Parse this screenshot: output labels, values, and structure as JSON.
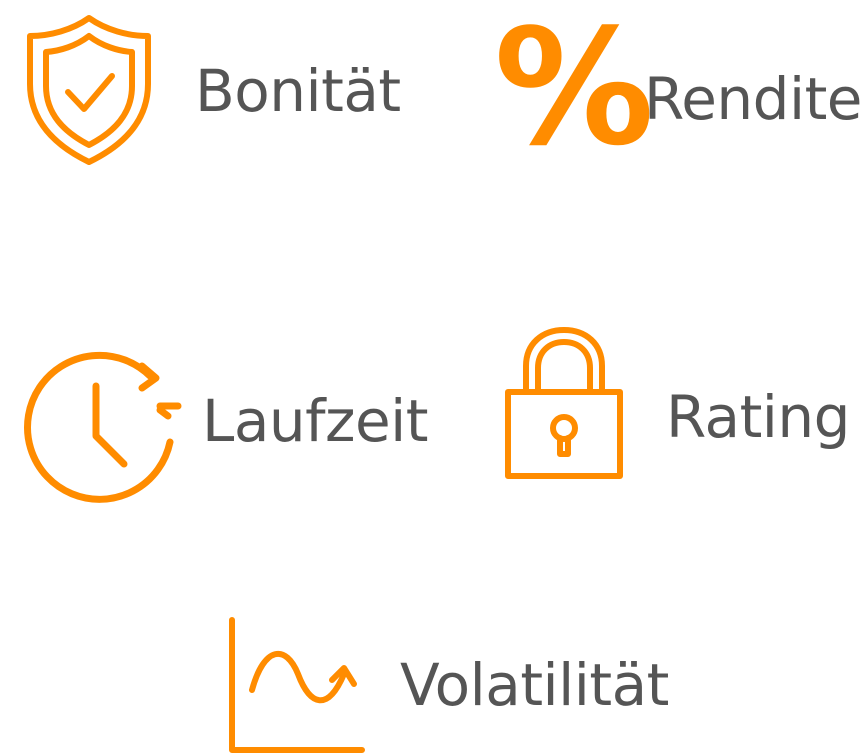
{
  "accent_color": "#FF8C00",
  "text_color": "#555555",
  "features": [
    {
      "icon": "shield-check-icon",
      "label": "Bonität"
    },
    {
      "icon": "percent-icon",
      "label": "Rendite",
      "symbol": "%"
    },
    {
      "icon": "clock-refresh-icon",
      "label": "Laufzeit"
    },
    {
      "icon": "padlock-icon",
      "label": "Rating"
    },
    {
      "icon": "wave-chart-icon",
      "label": "Volatilität"
    }
  ]
}
